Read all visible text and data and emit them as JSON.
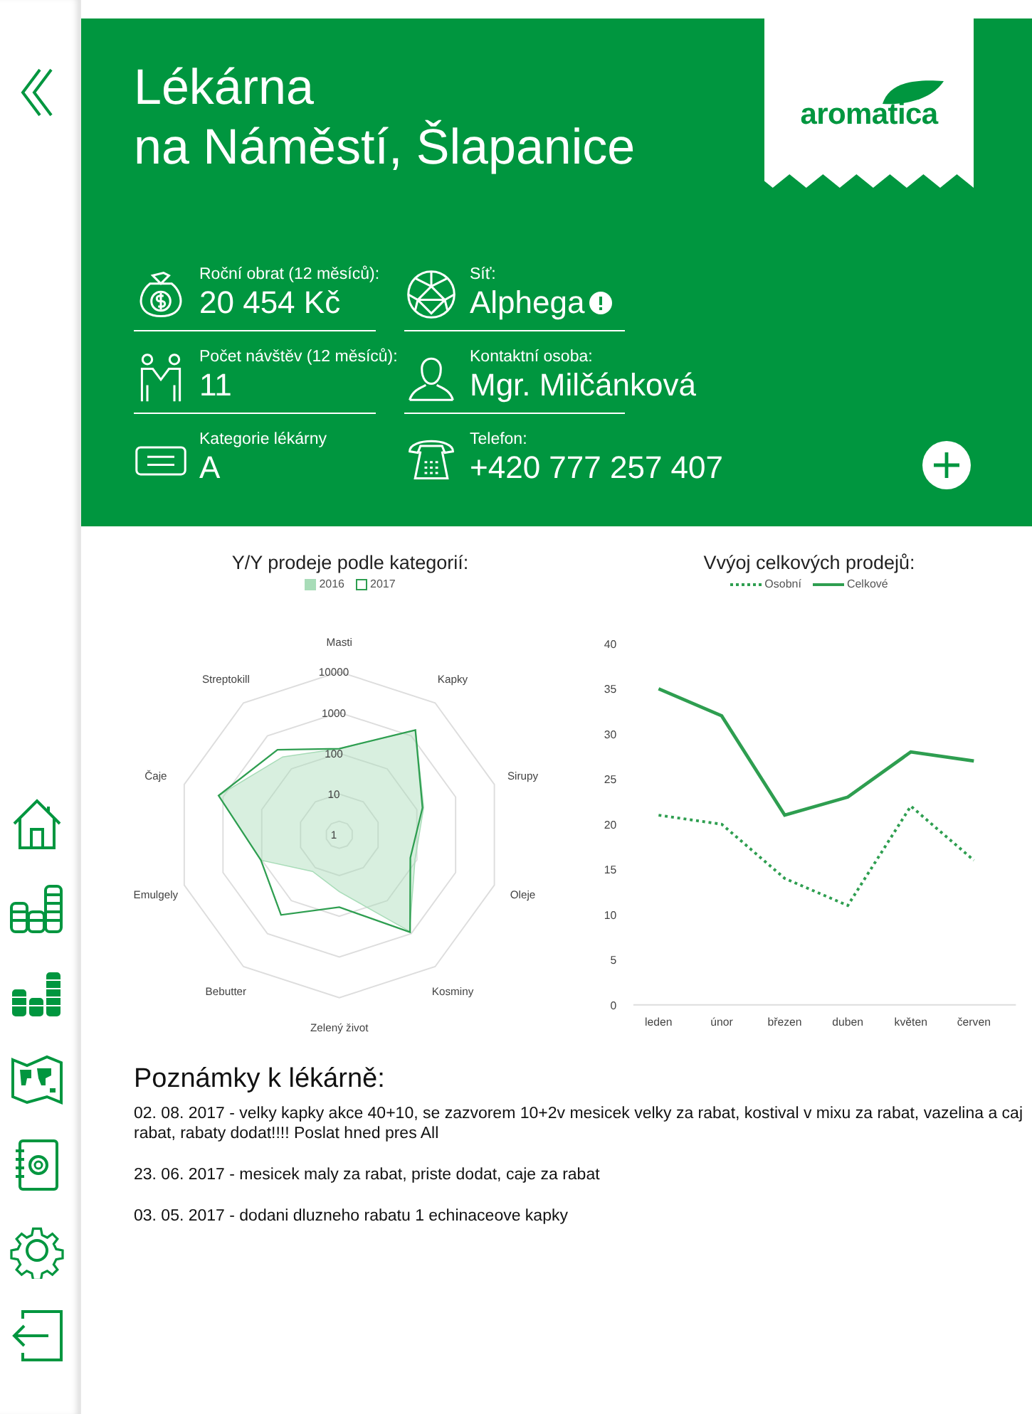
{
  "header": {
    "title_lines": [
      "Lékárna",
      "na Náměstí, Šlapanice"
    ],
    "logo_text": "aromatica"
  },
  "fields": [
    {
      "kind": "money",
      "label": "Roční obrat (12 měsíců):",
      "value": "20 454 Kč",
      "badge": false
    },
    {
      "kind": "network",
      "label": "Síť:",
      "value": "Alphega",
      "badge": true
    },
    {
      "kind": "people",
      "label": "Počet návštěv (12 měsíců):",
      "value": "11",
      "badge": false
    },
    {
      "kind": "person",
      "label": "Kontaktní osoba:",
      "value": "Mgr. Milčánková",
      "badge": false
    },
    {
      "kind": "card",
      "label": "Kategorie lékárny",
      "value": "A",
      "badge": false
    },
    {
      "kind": "phone",
      "label": "Telefon:",
      "value": "+420 777 257 407",
      "badge": false
    }
  ],
  "radar": {
    "title": "Y/Y prodeje podle kategorií:",
    "category_labels": [
      "Masti",
      "Kapky",
      "Sirupy",
      "Oleje",
      "Kosminy",
      "Zelený život",
      "Bebutter",
      "Emulgely",
      "Čaje",
      "Streptokill"
    ],
    "tick_labels": [
      "10000",
      "1000",
      "100",
      "10",
      "1"
    ],
    "legend": [
      {
        "name": "2016",
        "color": "#a8dcb8"
      },
      {
        "name": "2017",
        "color": "#2e9e50"
      }
    ]
  },
  "line": {
    "chart_data": {
      "type": "line",
      "legend": "top",
      "title": "Vvýoj celkových prodejů:",
      "categories": [
        "leden",
        "únor",
        "březen",
        "duben",
        "květen",
        "červen"
      ],
      "ylim": [
        0,
        40
      ],
      "yticks": [
        0,
        5,
        10,
        15,
        20,
        25,
        30,
        35,
        40
      ],
      "series": [
        {
          "name": "Osobní",
          "color": "#2e9e50",
          "line_style": "dotted",
          "values": [
            21,
            20,
            14,
            11,
            22,
            16
          ]
        },
        {
          "name": "Celkové",
          "color": "#2e9e50",
          "line_style": "solid",
          "values": [
            35,
            32,
            21,
            23,
            28,
            27
          ]
        }
      ]
    }
  },
  "notes": {
    "title": "Poznámky k lékárně:",
    "items": [
      "02. 08. 2017 - velky kapky akce 40+10, se zazvorem 10+2v mesicek velky za rabat, kostival v mixu za rabat, vazelina a caj rabat, rabaty dodat!!!! Poslat hned pres All",
      "23. 06. 2017 - mesicek maly za rabat, priste dodat, caje za rabat",
      "03. 05. 2017 - dodani dluzneho rabatu 1 echinaceove kapky"
    ]
  }
}
